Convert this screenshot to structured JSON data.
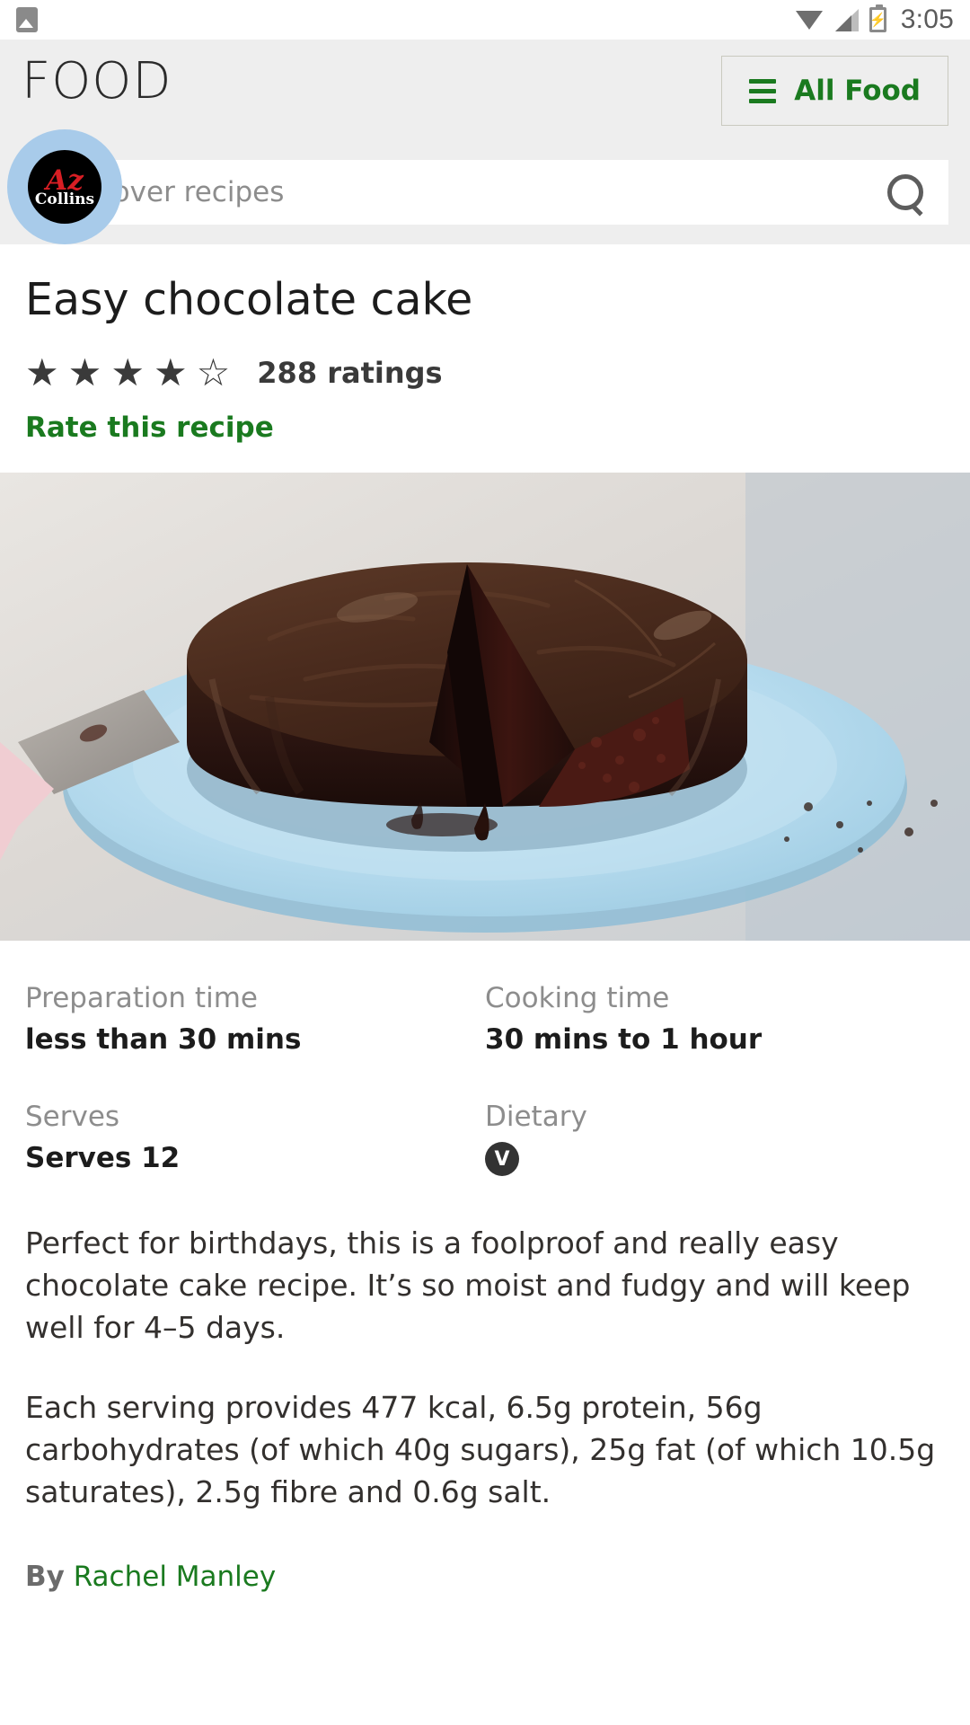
{
  "status_bar": {
    "time": "3:05",
    "icons": [
      "image-icon",
      "wifi-icon",
      "signal-icon",
      "battery-charging-icon"
    ],
    "battery_glyph": "⚡"
  },
  "header": {
    "brand": "FOOD",
    "menu_button_label": "All Food",
    "menu_icon": "hamburger-icon"
  },
  "search": {
    "placeholder": "Discover recipes",
    "value": "",
    "icon": "search-icon"
  },
  "overlay_bubble": {
    "logo_mark": "Az",
    "brand": "Collins",
    "bubble_color": "#a8cbea",
    "mark_color": "#d81e24"
  },
  "recipe": {
    "title": "Easy chocolate cake",
    "rating": {
      "filled_stars": 4,
      "total_stars": 5,
      "filled_glyph": "★",
      "empty_glyph": "☆",
      "count_text": "288 ratings",
      "rate_link": "Rate this recipe"
    },
    "hero_image_alt": "Chocolate cake with a slice removed on a pale blue plate",
    "meta": [
      {
        "label": "Preparation time",
        "value": "less than 30 mins",
        "type": "text"
      },
      {
        "label": "Cooking time",
        "value": "30 mins to 1 hour",
        "type": "text"
      },
      {
        "label": "Serves",
        "value": "Serves 12",
        "type": "text"
      },
      {
        "label": "Dietary",
        "value": "V",
        "type": "badge"
      }
    ],
    "description": [
      "Perfect for birthdays, this is a foolproof and really easy chocolate cake recipe. It’s so moist and fudgy and will keep well for 4–5 days.",
      "Each serving provides 477 kcal, 6.5g protein, 56g carbohydrates (of which 40g sugars), 25g fat (of which 10.5g saturates), 2.5g fibre and 0.6g salt."
    ],
    "byline": {
      "prefix": "By",
      "author": "Rachel Manley"
    }
  },
  "colors": {
    "accent_green": "#1a7a1f",
    "header_bg": "#eeeeee",
    "muted_text": "#8d8d8d",
    "body_text": "#33302e"
  }
}
